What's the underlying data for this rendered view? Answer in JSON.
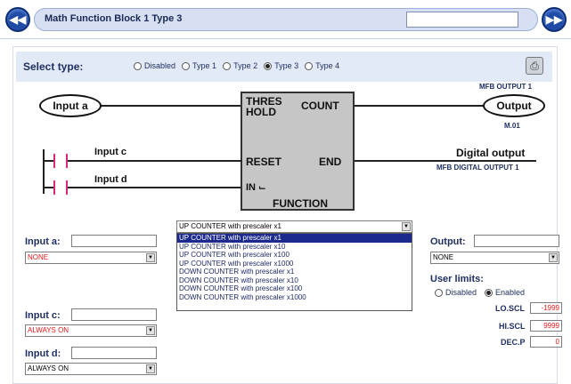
{
  "header": {
    "title": "Math Function Block 1 Type 3",
    "title_input_value": "",
    "back_icon": "double-left-arrow-icon",
    "forward_icon": "double-right-arrow-icon"
  },
  "select_type": {
    "label": "Select type:",
    "options": [
      "Disabled",
      "Type 1",
      "Type 2",
      "Type 3",
      "Type 4"
    ],
    "selected": "Type 3"
  },
  "printer_icon": "printer-icon",
  "diagram": {
    "input_a": "Input a",
    "input_c": "Input c",
    "input_d": "Input d",
    "output": "Output",
    "output_top": "MFB OUTPUT 1",
    "output_bottom": "M.01",
    "digital_output": "Digital output",
    "digital_output_sub": "MFB DIGITAL OUTPUT 1",
    "block": {
      "thres": "THRES",
      "hold": "HOLD",
      "count": "COUNT",
      "reset": "RESET",
      "end": "END",
      "in": "IN",
      "function": "FUNCTION"
    }
  },
  "function_select": {
    "value": "UP COUNTER with prescaler x1",
    "options": [
      "UP COUNTER with prescaler x1",
      "UP COUNTER with prescaler x10",
      "UP COUNTER with prescaler x100",
      "UP COUNTER with prescaler x1000",
      "DOWN COUNTER with prescaler x1",
      "DOWN COUNTER with prescaler x10",
      "DOWN COUNTER with prescaler x100",
      "DOWN COUNTER with prescaler x1000"
    ],
    "highlighted": "UP COUNTER with prescaler x1"
  },
  "inputs": {
    "input_a": {
      "label": "Input a:",
      "text_value": "",
      "select_value": "NONE"
    },
    "input_c": {
      "label": "Input c:",
      "text_value": "",
      "select_value": "ALWAYS ON"
    },
    "input_d": {
      "label": "Input d:",
      "text_value": "",
      "select_value": "ALWAYS ON"
    }
  },
  "output_panel": {
    "label": "Output:",
    "text_value": "",
    "select_value": "NONE",
    "user_limits_label": "User limits:",
    "limits_options": [
      "Disabled",
      "Enabled"
    ],
    "limits_selected": "Enabled",
    "lo_scl_label": "LO.SCL",
    "lo_scl_value": "-1999",
    "hi_scl_label": "HI.SCL",
    "hi_scl_value": "9999",
    "dec_p_label": "DEC.P",
    "dec_p_value": "0"
  },
  "colors": {
    "accent": "#1f4aa6",
    "title_bar": "#d7dff3",
    "select_bar": "#e3eaf7",
    "red_value": "#e01818",
    "highlight": "#1b2a8c"
  }
}
